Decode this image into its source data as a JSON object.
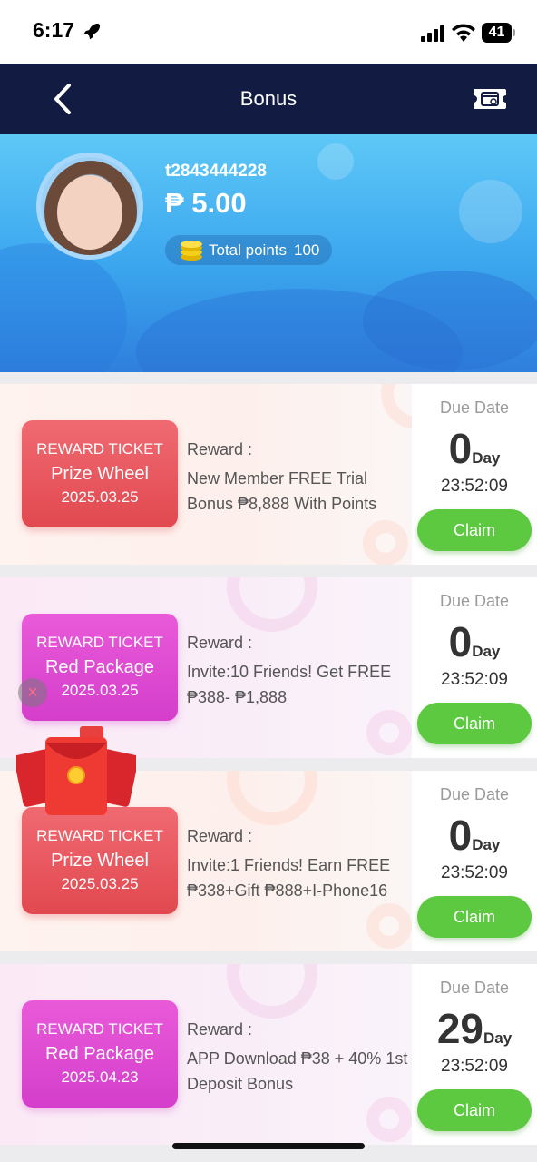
{
  "status": {
    "time": "6:17",
    "battery": "41",
    "icons": [
      "rocket-icon",
      "signal-icon",
      "wifi-icon",
      "battery-icon"
    ]
  },
  "nav": {
    "title": "Bonus",
    "back_icon": "chevron-left-icon",
    "right_icon": "ticket-icon"
  },
  "profile": {
    "username": "t2843444228",
    "balance": "₱ 5.00",
    "points_label": "Total points",
    "points_value": "100"
  },
  "cards": [
    {
      "theme": "red",
      "ticket_type": "REWARD TICKET",
      "ticket_name": "Prize Wheel",
      "ticket_date": "2025.03.25",
      "reward_label": "Reward :",
      "reward_text": "New Member FREE Trial Bonus ₱8,888 With Points",
      "due_label": "Due Date",
      "days": "0",
      "day_unit": "Day",
      "countdown": "23:52:09",
      "claim_label": "Claim"
    },
    {
      "theme": "pink",
      "ticket_type": "REWARD TICKET",
      "ticket_name": "Red Package",
      "ticket_date": "2025.03.25",
      "reward_label": "Reward :",
      "reward_text": "Invite:10 Friends! Get FREE ₱388- ₱1,888",
      "due_label": "Due Date",
      "days": "0",
      "day_unit": "Day",
      "countdown": "23:52:09",
      "claim_label": "Claim"
    },
    {
      "theme": "red",
      "ticket_type": "REWARD TICKET",
      "ticket_name": "Prize Wheel",
      "ticket_date": "2025.03.25",
      "reward_label": "Reward :",
      "reward_text": "Invite:1 Friends! Earn FREE ₱338+Gift ₱888+I-Phone16",
      "due_label": "Due Date",
      "days": "0",
      "day_unit": "Day",
      "countdown": "23:52:09",
      "claim_label": "Claim"
    },
    {
      "theme": "pink",
      "ticket_type": "REWARD TICKET",
      "ticket_name": "Red Package",
      "ticket_date": "2025.04.23",
      "reward_label": "Reward :",
      "reward_text": "APP Download ₱38 + 40% 1st Deposit Bonus",
      "due_label": "Due Date",
      "days": "29",
      "day_unit": "Day",
      "countdown": "23:52:09",
      "claim_label": "Claim"
    }
  ],
  "floating": {
    "close_glyph": "×",
    "envelope_icon": "red-envelope-icon"
  },
  "colors": {
    "nav_bg": "#121b41",
    "claim_green": "#5cc940",
    "ticket_red": "#e2484f",
    "ticket_pink": "#d43ecb"
  }
}
